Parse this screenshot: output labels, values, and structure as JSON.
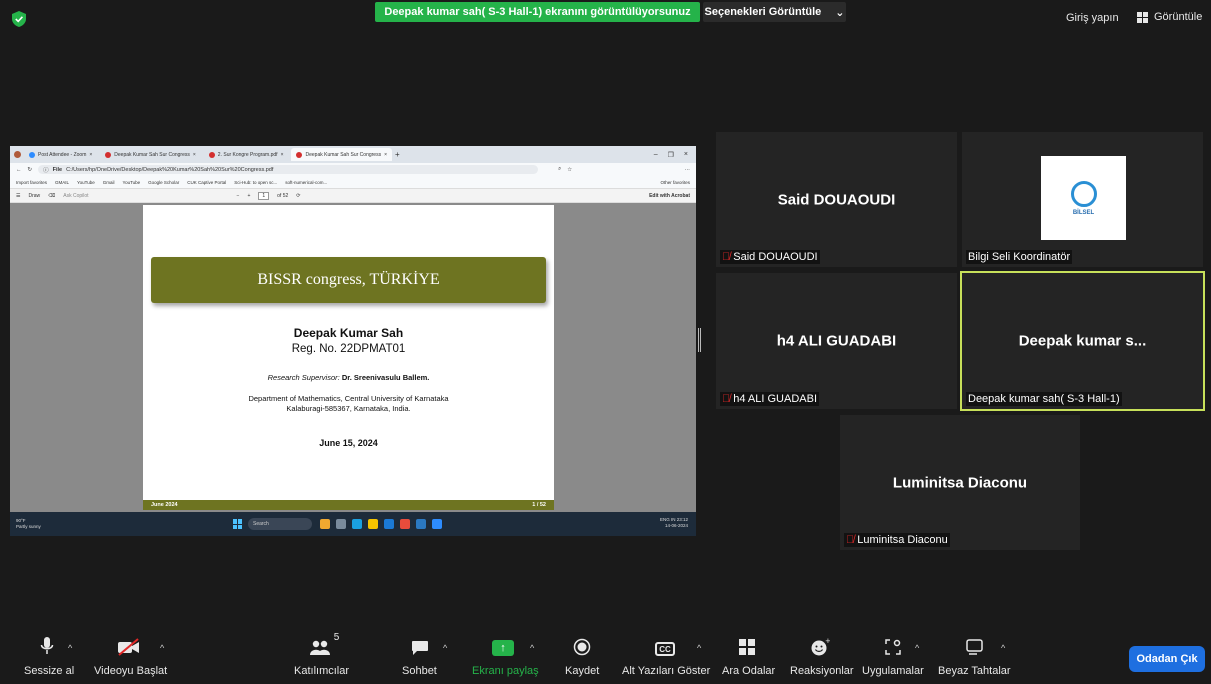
{
  "top": {
    "share_banner": "Deepak kumar sah( S-3 Hall-1) ekranını görüntülüyorsunuz",
    "view_options": "Seçenekleri Görüntüle",
    "signin": "Giriş yapın",
    "view": "Görüntüle"
  },
  "browser": {
    "tabs": [
      {
        "label": "Post Attendee - Zoom",
        "color": "#2d8cff"
      },
      {
        "label": "Deepak Kumar Sah Sur Congress",
        "color": "#d32f2f"
      },
      {
        "label": "2. Sur Kongre Program.pdf",
        "color": "#d32f2f"
      },
      {
        "label": "Deepak Kumar Sah Sur Congress",
        "color": "#d32f2f"
      }
    ],
    "url_prefix": "File",
    "url": "C:/Users/hp/OneDrive/Desktop/Deepak%20Kumar%20Sah%20Sur%20Congress.pdf",
    "favorites": [
      "Import favorites",
      "GMAIL",
      "YouTube",
      "Gmail",
      "YouTube",
      "Google Scholar",
      "CUK Captive Portal",
      "Sci-Hub: to open sc...",
      "soft-numerical-com..."
    ],
    "other_favorites": "Other favorites",
    "pdf_draw": "Draw",
    "pdf_ask": "Ask Copilot",
    "pdf_page": "1",
    "pdf_of": "of 52",
    "pdf_acrobat": "Edit with Acrobat"
  },
  "slide": {
    "title": "BISSR congress, TÜRKİYE",
    "name": "Deepak Kumar Sah",
    "reg": "Reg. No. 22DPMAT01",
    "supervisor_label": "Research Supervisor:",
    "supervisor_name": "Dr. Sreenivasulu Ballem.",
    "dept_line1": "Department of Mathematics, Central University of Karnataka",
    "dept_line2": "Kalaburagi-585367, Karnataka, India.",
    "date": "June 15, 2024",
    "footer_left": "June 2024",
    "footer_right": "1 / 52"
  },
  "taskbar": {
    "weather_temp": "90°F",
    "weather_desc": "Partly sunny",
    "search": "Search",
    "lang": "ENG IN",
    "time": "23:12",
    "date": "14-06-2024"
  },
  "tiles": [
    {
      "center": "Said DOUAOUDI",
      "label": "Said DOUAOUDI",
      "muted": true
    },
    {
      "center": "",
      "label": "Bilgi Seli Koordinatör",
      "muted": false,
      "logo_text": "BİLSEL"
    },
    {
      "center": "h4 ALI GUADABI",
      "label": "h4 ALI GUADABI",
      "muted": true
    },
    {
      "center": "Deepak kumar s...",
      "label": "Deepak kumar sah( S-3 Hall-1)",
      "muted": false
    },
    {
      "center": "Luminitsa Diaconu",
      "label": "Luminitsa Diaconu",
      "muted": true
    }
  ],
  "toolbar": {
    "mute": "Sessize al",
    "video": "Videoyu Başlat",
    "participants": "Katılımcılar",
    "participants_count": "5",
    "chat": "Sohbet",
    "share": "Ekranı paylaş",
    "record": "Kaydet",
    "captions": "Alt Yazıları Göster",
    "cc": "CC",
    "breakout": "Ara Odalar",
    "reactions": "Reaksiyonlar",
    "apps": "Uygulamalar",
    "whiteboard": "Beyaz Tahtalar",
    "leave": "Odadan Çık"
  },
  "colors": {
    "share_green": "#25b34a",
    "slide_olive": "#6e7421",
    "active_speaker": "#c7e05a",
    "leave_blue": "#1e6fe0"
  }
}
